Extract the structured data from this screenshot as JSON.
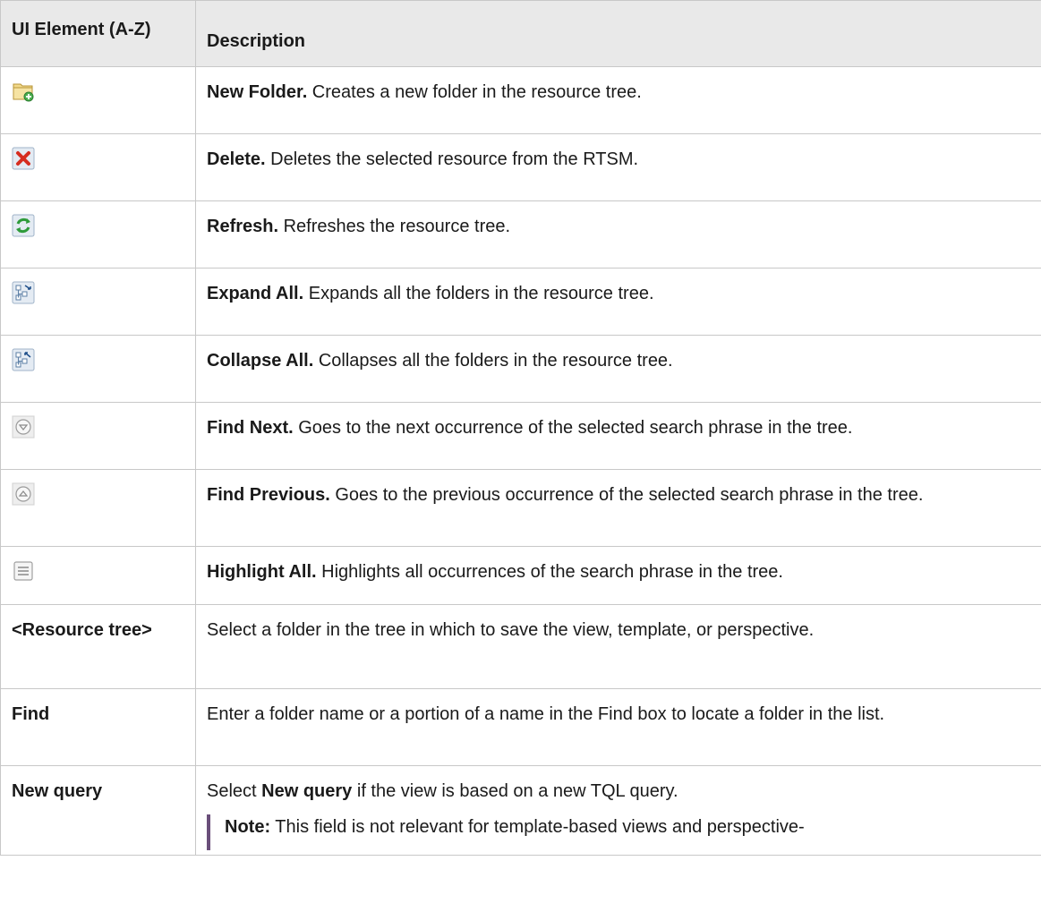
{
  "table": {
    "header": {
      "col1": "UI Element (A-Z)",
      "col2": "Description"
    },
    "rows": [
      {
        "icon": "new-folder-icon",
        "term": "New Folder.",
        "text": " Creates a new folder in the resource tree."
      },
      {
        "icon": "delete-icon",
        "term": "Delete.",
        "text": " Deletes the selected resource from the RTSM."
      },
      {
        "icon": "refresh-icon",
        "term": "Refresh.",
        "text": " Refreshes the resource tree."
      },
      {
        "icon": "expand-all-icon",
        "term": "Expand All.",
        "text": " Expands all the folders in the resource tree."
      },
      {
        "icon": "collapse-all-icon",
        "term": "Collapse All.",
        "text": " Collapses all the folders in the resource tree."
      },
      {
        "icon": "find-next-icon",
        "term": "Find Next.",
        "text": " Goes to the next occurrence of the selected search phrase in the tree."
      },
      {
        "icon": "find-previous-icon",
        "term": "Find Previous.",
        "text": " Goes to the previous occurrence of the selected search phrase in the tree."
      },
      {
        "icon": "highlight-all-icon",
        "term": "Highlight All.",
        "text": " Highlights all occurrences of the search phrase in the tree."
      },
      {
        "element": "<Resource tree>",
        "text": "Select a folder in the tree in which to save the view, template, or perspective."
      },
      {
        "element": "Find",
        "text": "Enter a folder name or a portion of a name in the Find box to locate a folder in the list."
      },
      {
        "element": "New query",
        "text_before": "Select ",
        "text_bold": "New query",
        "text_after": " if the view is based on a new TQL query.",
        "note_label": "Note:",
        "note_text": " This field is not relevant for template-based views and perspective-"
      }
    ]
  },
  "colors": {
    "header_bg": "#e9e9e9",
    "border": "#c8c8c8",
    "note_bar": "#6a4f7a"
  }
}
